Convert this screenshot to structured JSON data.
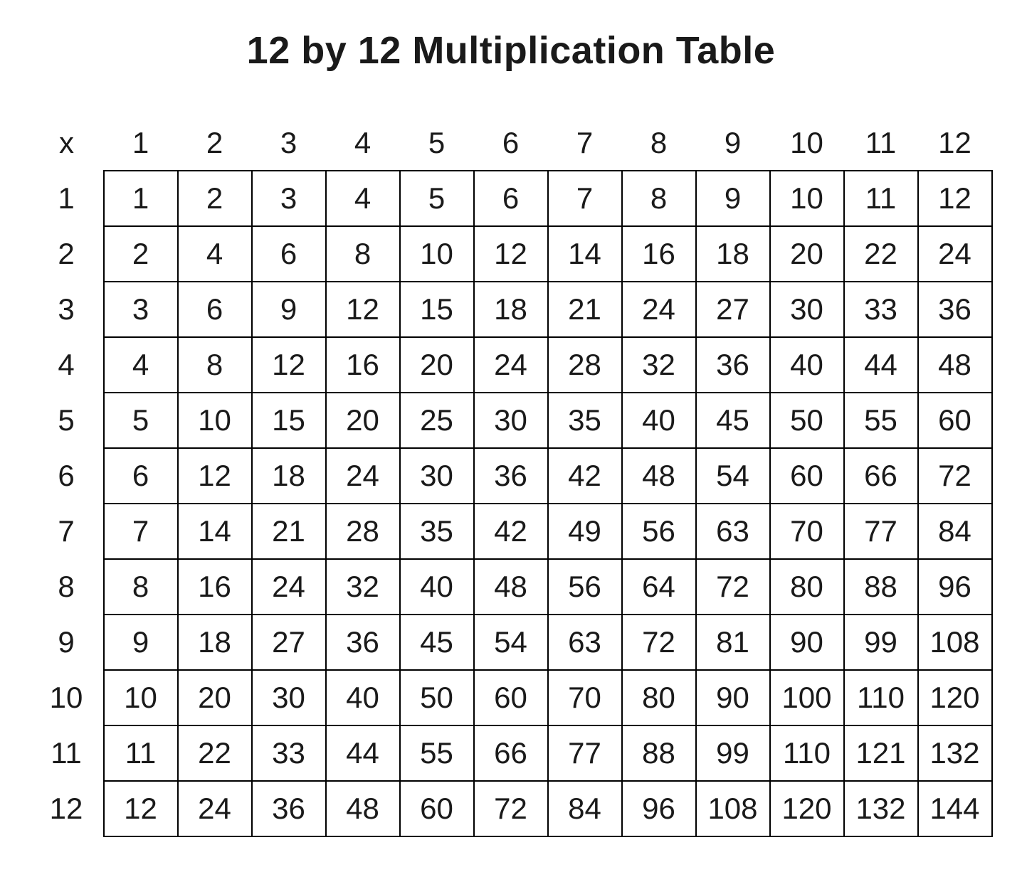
{
  "title": "12 by 12 Multiplication Table",
  "corner_label": "x",
  "col_headers": [
    "1",
    "2",
    "3",
    "4",
    "5",
    "6",
    "7",
    "8",
    "9",
    "10",
    "11",
    "12"
  ],
  "row_headers": [
    "1",
    "2",
    "3",
    "4",
    "5",
    "6",
    "7",
    "8",
    "9",
    "10",
    "11",
    "12"
  ],
  "rows": [
    [
      "1",
      "2",
      "3",
      "4",
      "5",
      "6",
      "7",
      "8",
      "9",
      "10",
      "11",
      "12"
    ],
    [
      "2",
      "4",
      "6",
      "8",
      "10",
      "12",
      "14",
      "16",
      "18",
      "20",
      "22",
      "24"
    ],
    [
      "3",
      "6",
      "9",
      "12",
      "15",
      "18",
      "21",
      "24",
      "27",
      "30",
      "33",
      "36"
    ],
    [
      "4",
      "8",
      "12",
      "16",
      "20",
      "24",
      "28",
      "32",
      "36",
      "40",
      "44",
      "48"
    ],
    [
      "5",
      "10",
      "15",
      "20",
      "25",
      "30",
      "35",
      "40",
      "45",
      "50",
      "55",
      "60"
    ],
    [
      "6",
      "12",
      "18",
      "24",
      "30",
      "36",
      "42",
      "48",
      "54",
      "60",
      "66",
      "72"
    ],
    [
      "7",
      "14",
      "21",
      "28",
      "35",
      "42",
      "49",
      "56",
      "63",
      "70",
      "77",
      "84"
    ],
    [
      "8",
      "16",
      "24",
      "32",
      "40",
      "48",
      "56",
      "64",
      "72",
      "80",
      "88",
      "96"
    ],
    [
      "9",
      "18",
      "27",
      "36",
      "45",
      "54",
      "63",
      "72",
      "81",
      "90",
      "99",
      "108"
    ],
    [
      "10",
      "20",
      "30",
      "40",
      "50",
      "60",
      "70",
      "80",
      "90",
      "100",
      "110",
      "120"
    ],
    [
      "11",
      "22",
      "33",
      "44",
      "55",
      "66",
      "77",
      "88",
      "99",
      "110",
      "121",
      "132"
    ],
    [
      "12",
      "24",
      "36",
      "48",
      "60",
      "72",
      "84",
      "96",
      "108",
      "120",
      "132",
      "144"
    ]
  ],
  "chart_data": {
    "type": "table",
    "title": "12 by 12 Multiplication Table",
    "xlabel": "",
    "ylabel": "",
    "categories": [
      1,
      2,
      3,
      4,
      5,
      6,
      7,
      8,
      9,
      10,
      11,
      12
    ],
    "series": [
      {
        "name": "1",
        "values": [
          1,
          2,
          3,
          4,
          5,
          6,
          7,
          8,
          9,
          10,
          11,
          12
        ]
      },
      {
        "name": "2",
        "values": [
          2,
          4,
          6,
          8,
          10,
          12,
          14,
          16,
          18,
          20,
          22,
          24
        ]
      },
      {
        "name": "3",
        "values": [
          3,
          6,
          9,
          12,
          15,
          18,
          21,
          24,
          27,
          30,
          33,
          36
        ]
      },
      {
        "name": "4",
        "values": [
          4,
          8,
          12,
          16,
          20,
          24,
          28,
          32,
          36,
          40,
          44,
          48
        ]
      },
      {
        "name": "5",
        "values": [
          5,
          10,
          15,
          20,
          25,
          30,
          35,
          40,
          45,
          50,
          55,
          60
        ]
      },
      {
        "name": "6",
        "values": [
          6,
          12,
          18,
          24,
          30,
          36,
          42,
          48,
          54,
          60,
          66,
          72
        ]
      },
      {
        "name": "7",
        "values": [
          7,
          14,
          21,
          28,
          35,
          42,
          49,
          56,
          63,
          70,
          77,
          84
        ]
      },
      {
        "name": "8",
        "values": [
          8,
          16,
          24,
          32,
          40,
          48,
          56,
          64,
          72,
          80,
          88,
          96
        ]
      },
      {
        "name": "9",
        "values": [
          9,
          18,
          27,
          36,
          45,
          54,
          63,
          72,
          81,
          90,
          99,
          108
        ]
      },
      {
        "name": "10",
        "values": [
          10,
          20,
          30,
          40,
          50,
          60,
          70,
          80,
          90,
          100,
          110,
          120
        ]
      },
      {
        "name": "11",
        "values": [
          11,
          22,
          33,
          44,
          55,
          66,
          77,
          88,
          99,
          110,
          121,
          132
        ]
      },
      {
        "name": "12",
        "values": [
          12,
          24,
          36,
          48,
          60,
          72,
          84,
          96,
          108,
          120,
          132,
          144
        ]
      }
    ]
  }
}
